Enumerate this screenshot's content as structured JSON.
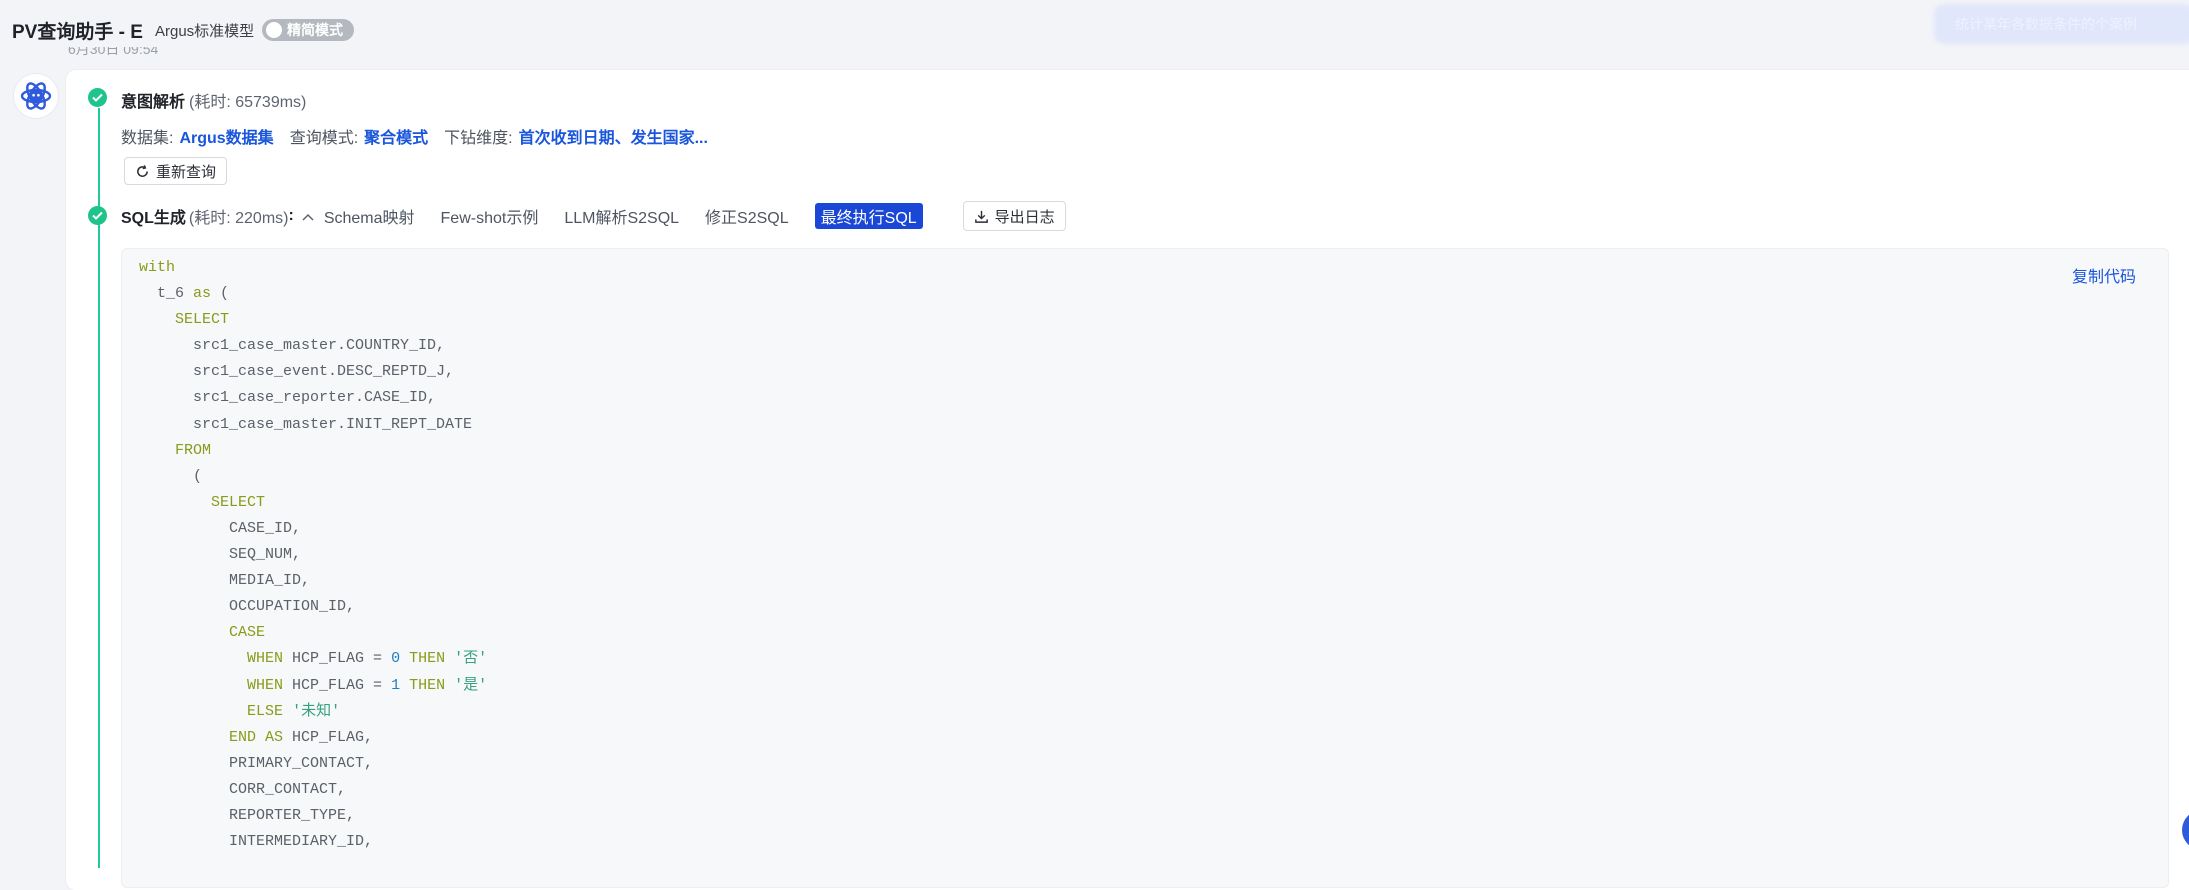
{
  "header": {
    "app_title": "PV查询助手 - E",
    "model_name": "Argus标准模型",
    "mode_toggle_label": "精简模式",
    "blurred_button_text": "统计某年各数据条件的个案例",
    "timestamp": "6月30日 09:54"
  },
  "step_intent": {
    "title": "意图解析",
    "time": "(耗时: 65739ms)",
    "dataset_label": "数据集:",
    "dataset_value": "Argus数据集",
    "query_mode_label": "查询模式:",
    "query_mode_value": "聚合模式",
    "drill_label": "下钻维度:",
    "drill_value": "首次收到日期、发生国家...",
    "requery_label": "重新查询"
  },
  "step_sql": {
    "title": "SQL生成",
    "time": "(耗时: 220ms)",
    "colon": ":",
    "tabs": [
      {
        "label": "Schema映射",
        "active": false
      },
      {
        "label": "Few-shot示例",
        "active": false
      },
      {
        "label": "LLM解析S2SQL",
        "active": false
      },
      {
        "label": "修正S2SQL",
        "active": false
      },
      {
        "label": "最终执行SQL",
        "active": true
      }
    ],
    "export_label": "导出日志",
    "copy_code_label": "复制代码"
  },
  "code_lines": [
    [
      {
        "t": "with",
        "c": "kw"
      }
    ],
    [
      {
        "t": "  t_6 "
      },
      {
        "t": "as",
        "c": "kw"
      },
      {
        "t": " ("
      }
    ],
    [
      {
        "t": "    "
      },
      {
        "t": "SELECT",
        "c": "kw"
      }
    ],
    [
      {
        "t": "      src1_case_master.COUNTRY_ID,"
      }
    ],
    [
      {
        "t": "      src1_case_event.DESC_REPTD_J,"
      }
    ],
    [
      {
        "t": "      src1_case_reporter.CASE_ID,"
      }
    ],
    [
      {
        "t": "      src1_case_master.INIT_REPT_DATE"
      }
    ],
    [
      {
        "t": "    "
      },
      {
        "t": "FROM",
        "c": "kw"
      }
    ],
    [
      {
        "t": "      ("
      }
    ],
    [
      {
        "t": "        "
      },
      {
        "t": "SELECT",
        "c": "kw"
      }
    ],
    [
      {
        "t": "          CASE_ID,"
      }
    ],
    [
      {
        "t": "          SEQ_NUM,"
      }
    ],
    [
      {
        "t": "          MEDIA_ID,"
      }
    ],
    [
      {
        "t": "          OCCUPATION_ID,"
      }
    ],
    [
      {
        "t": "          "
      },
      {
        "t": "CASE",
        "c": "kw"
      }
    ],
    [
      {
        "t": "            "
      },
      {
        "t": "WHEN",
        "c": "kw"
      },
      {
        "t": " HCP_FLAG = "
      },
      {
        "t": "0",
        "c": "num"
      },
      {
        "t": " "
      },
      {
        "t": "THEN",
        "c": "kw"
      },
      {
        "t": " "
      },
      {
        "t": "'否'",
        "c": "str"
      }
    ],
    [
      {
        "t": "            "
      },
      {
        "t": "WHEN",
        "c": "kw"
      },
      {
        "t": " HCP_FLAG = "
      },
      {
        "t": "1",
        "c": "num"
      },
      {
        "t": " "
      },
      {
        "t": "THEN",
        "c": "kw"
      },
      {
        "t": " "
      },
      {
        "t": "'是'",
        "c": "str"
      }
    ],
    [
      {
        "t": "            "
      },
      {
        "t": "ELSE",
        "c": "kw"
      },
      {
        "t": " "
      },
      {
        "t": "'未知'",
        "c": "str"
      }
    ],
    [
      {
        "t": "          "
      },
      {
        "t": "END AS",
        "c": "kw"
      },
      {
        "t": " HCP_FLAG,"
      }
    ],
    [
      {
        "t": "          PRIMARY_CONTACT,"
      }
    ],
    [
      {
        "t": "          CORR_CONTACT,"
      }
    ],
    [
      {
        "t": "          REPORTER_TYPE,"
      }
    ],
    [
      {
        "t": "          INTERMEDIARY_ID,"
      }
    ]
  ]
}
